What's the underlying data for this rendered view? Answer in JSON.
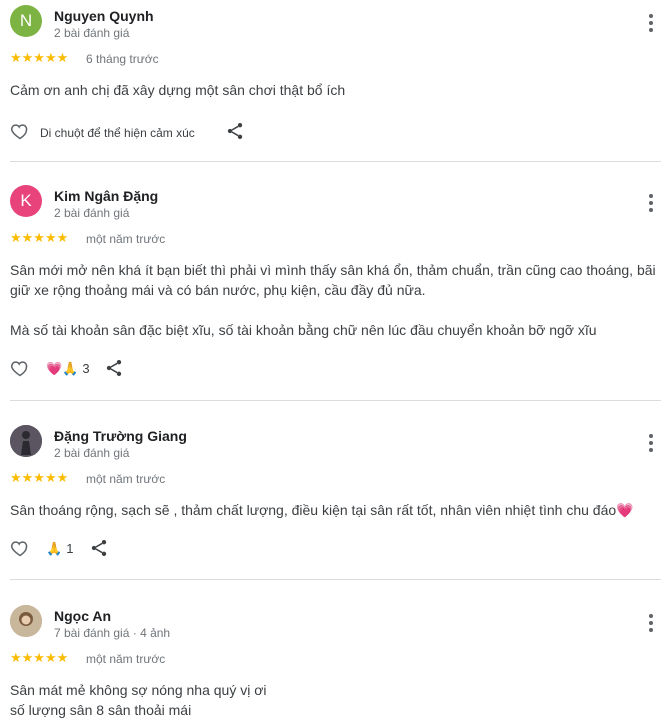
{
  "reviews": [
    {
      "name": "Nguyen Quynh",
      "initial": "N",
      "avatar_color": "#7cb342",
      "subtitle": "2 bài đánh giá",
      "stars": "★★★★★",
      "time": "6 tháng trước",
      "text": [
        "Cảm ơn anh chị đã xây dựng một sân chơi thật bổ ích"
      ],
      "hint": "Di chuột để thể hiện cảm xúc"
    },
    {
      "name": "Kim Ngân Đặng",
      "initial": "K",
      "avatar_color": "#e8437a",
      "subtitle": "2 bài đánh giá",
      "stars": "★★★★★",
      "time": "một năm trước",
      "text": [
        "Sân mới mở nên khá ít bạn biết thì phải vì mình thấy sân khá ổn, thảm chuẩn, trần cũng cao thoáng, bãi",
        "giữ xe rộng thoảng mái và có bán nước, phụ kiện, cầu đầy đủ nữa.",
        "Mà số tài khoản sân đặc biệt xĩu, số tài khoản bằng chữ nên lúc đầu chuyển khoản bỡ ngỡ xĩu"
      ],
      "reactions": "💗🙏",
      "reaction_count": "3"
    },
    {
      "name": "Đặng Trường Giang",
      "subtitle": "2 bài đánh giá",
      "stars": "★★★★★",
      "time": "một năm trước",
      "text": [
        "Sân thoáng rộng, sạch sẽ , thảm chất lượng, điều kiện tại sân rất tốt, nhân viên nhiệt tình chu đáo💗"
      ],
      "reactions": "🙏",
      "reaction_count": "1"
    },
    {
      "name": "Ngọc An",
      "subtitle": "7 bài đánh giá · 4 ảnh",
      "stars": "★★★★★",
      "time": "một năm trước",
      "text": [
        "Sân mát mẻ không sợ nóng nha quý vị ơi",
        "số lượng sân 8 sân thoải mái"
      ]
    }
  ]
}
